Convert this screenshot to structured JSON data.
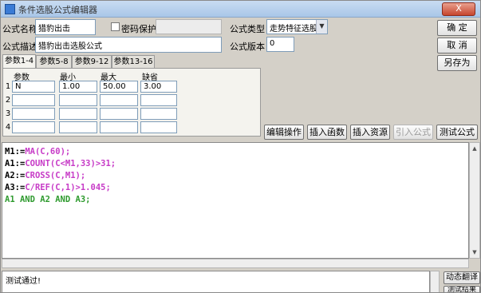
{
  "window": {
    "title": "条件选股公式编辑器",
    "close_label": "X"
  },
  "form": {
    "name_label": "公式名称",
    "name_value": "猎豹出击",
    "password_label": "密码保护",
    "password_value": "",
    "desc_label": "公式描述",
    "desc_value": "猎豹出击选股公式",
    "type_label": "公式类型",
    "type_value": "走势特征选股",
    "version_label": "公式版本",
    "version_value": "0"
  },
  "side_buttons": {
    "ok": "确  定",
    "cancel": "取  消",
    "save_as": "另存为"
  },
  "tabs": [
    "参数1-4",
    "参数5-8",
    "参数9-12",
    "参数13-16"
  ],
  "params": {
    "headers": [
      "参数",
      "最小",
      "最大",
      "缺省"
    ],
    "rows": [
      {
        "num": "1",
        "name": "N",
        "min": "1.00",
        "max": "50.00",
        "def": "3.00"
      },
      {
        "num": "2",
        "name": "",
        "min": "",
        "max": "",
        "def": ""
      },
      {
        "num": "3",
        "name": "",
        "min": "",
        "max": "",
        "def": ""
      },
      {
        "num": "4",
        "name": "",
        "min": "",
        "max": "",
        "def": ""
      }
    ]
  },
  "action_buttons": {
    "edit_op": "编辑操作",
    "insert_func": "插入函数",
    "insert_res": "插入资源",
    "import_formula": "引入公式",
    "test_formula": "测试公式"
  },
  "code": {
    "lines": [
      {
        "var": "M1",
        "op": ":=",
        "text": "MA(C,60);"
      },
      {
        "var": "A1",
        "op": ":=",
        "text": "COUNT(C<M1,33)>31;"
      },
      {
        "var": "A2",
        "op": ":=",
        "text": "CROSS(C,M1);"
      },
      {
        "var": "A3",
        "op": ":=",
        "text": "C/REF(C,1)>1.045;"
      }
    ],
    "final_line": "A1 AND A2 AND A3;"
  },
  "status": {
    "message": "测试通过!"
  },
  "bottom_buttons": {
    "dynamic_translate": "动态翻译",
    "test_result": "测试结果"
  },
  "colors": {
    "keyword": "#2e9a2e",
    "func": "#c73bc7",
    "number": "#c9a800",
    "var": "#000000"
  }
}
